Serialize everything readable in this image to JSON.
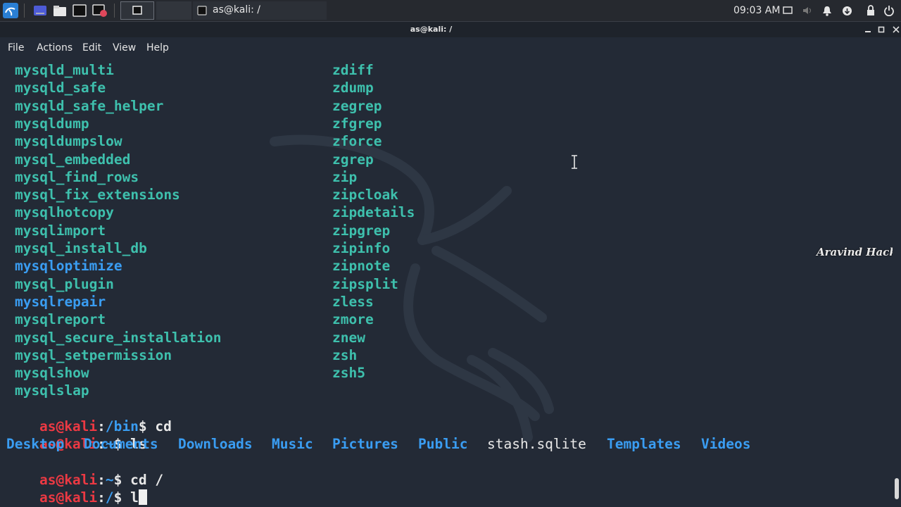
{
  "taskbar": {
    "window_title": "as@kali: /",
    "clock": "09:03 AM"
  },
  "window": {
    "title": "as@kali: /"
  },
  "menu": [
    "File",
    "Actions",
    "Edit",
    "View",
    "Help"
  ],
  "listing": {
    "left": [
      {
        "text": "mysqld_multi",
        "color": "teal"
      },
      {
        "text": "mysqld_safe",
        "color": "teal"
      },
      {
        "text": "mysqld_safe_helper",
        "color": "teal"
      },
      {
        "text": "mysqldump",
        "color": "teal"
      },
      {
        "text": "mysqldumpslow",
        "color": "teal"
      },
      {
        "text": "mysql_embedded",
        "color": "teal"
      },
      {
        "text": "mysql_find_rows",
        "color": "teal"
      },
      {
        "text": "mysql_fix_extensions",
        "color": "teal"
      },
      {
        "text": "mysqlhotcopy",
        "color": "teal"
      },
      {
        "text": "mysqlimport",
        "color": "teal"
      },
      {
        "text": "mysql_install_db",
        "color": "teal"
      },
      {
        "text": "mysqloptimize",
        "color": "blue"
      },
      {
        "text": "mysql_plugin",
        "color": "teal"
      },
      {
        "text": "mysqlrepair",
        "color": "blue"
      },
      {
        "text": "mysqlreport",
        "color": "teal"
      },
      {
        "text": "mysql_secure_installation",
        "color": "teal"
      },
      {
        "text": "mysql_setpermission",
        "color": "teal"
      },
      {
        "text": "mysqlshow",
        "color": "teal"
      },
      {
        "text": "mysqlslap",
        "color": "teal"
      }
    ],
    "right": [
      {
        "text": "zdiff",
        "color": "teal"
      },
      {
        "text": "zdump",
        "color": "teal"
      },
      {
        "text": "zegrep",
        "color": "teal"
      },
      {
        "text": "zfgrep",
        "color": "teal"
      },
      {
        "text": "zforce",
        "color": "teal"
      },
      {
        "text": "zgrep",
        "color": "teal"
      },
      {
        "text": "zip",
        "color": "teal"
      },
      {
        "text": "zipcloak",
        "color": "teal"
      },
      {
        "text": "zipdetails",
        "color": "teal"
      },
      {
        "text": "zipgrep",
        "color": "teal"
      },
      {
        "text": "zipinfo",
        "color": "teal"
      },
      {
        "text": "zipnote",
        "color": "teal"
      },
      {
        "text": "zipsplit",
        "color": "teal"
      },
      {
        "text": "zless",
        "color": "teal"
      },
      {
        "text": "zmore",
        "color": "teal"
      },
      {
        "text": "znew",
        "color": "teal"
      },
      {
        "text": "zsh",
        "color": "teal"
      },
      {
        "text": "zsh5",
        "color": "teal"
      }
    ]
  },
  "history": [
    {
      "user": "as@kali",
      "path": "/bin",
      "cmd": "$ cd"
    },
    {
      "user": "as@kali",
      "path": "~",
      "cmd": "$ ls"
    },
    {
      "user": "as@kali",
      "path": "~",
      "cmd": "$ cd /"
    },
    {
      "user": "as@kali",
      "path": "/",
      "cmd": "$ l"
    }
  ],
  "ls_output": [
    {
      "text": "Desktop",
      "type": "dir"
    },
    {
      "text": "Documents",
      "type": "dir"
    },
    {
      "text": "Downloads",
      "type": "dir"
    },
    {
      "text": "Music",
      "type": "dir"
    },
    {
      "text": "Pictures",
      "type": "dir"
    },
    {
      "text": "Public",
      "type": "dir"
    },
    {
      "text": "stash.sqlite",
      "type": "file"
    },
    {
      "text": "Templates",
      "type": "dir"
    },
    {
      "text": "Videos",
      "type": "dir"
    }
  ],
  "watermark": "Aravind Hack",
  "colors": {
    "background": "#232a36",
    "teal": "#3ec0ad",
    "blue": "#3a9df2",
    "prompt_user": "#ec3943",
    "text": "#e8e8e8"
  }
}
